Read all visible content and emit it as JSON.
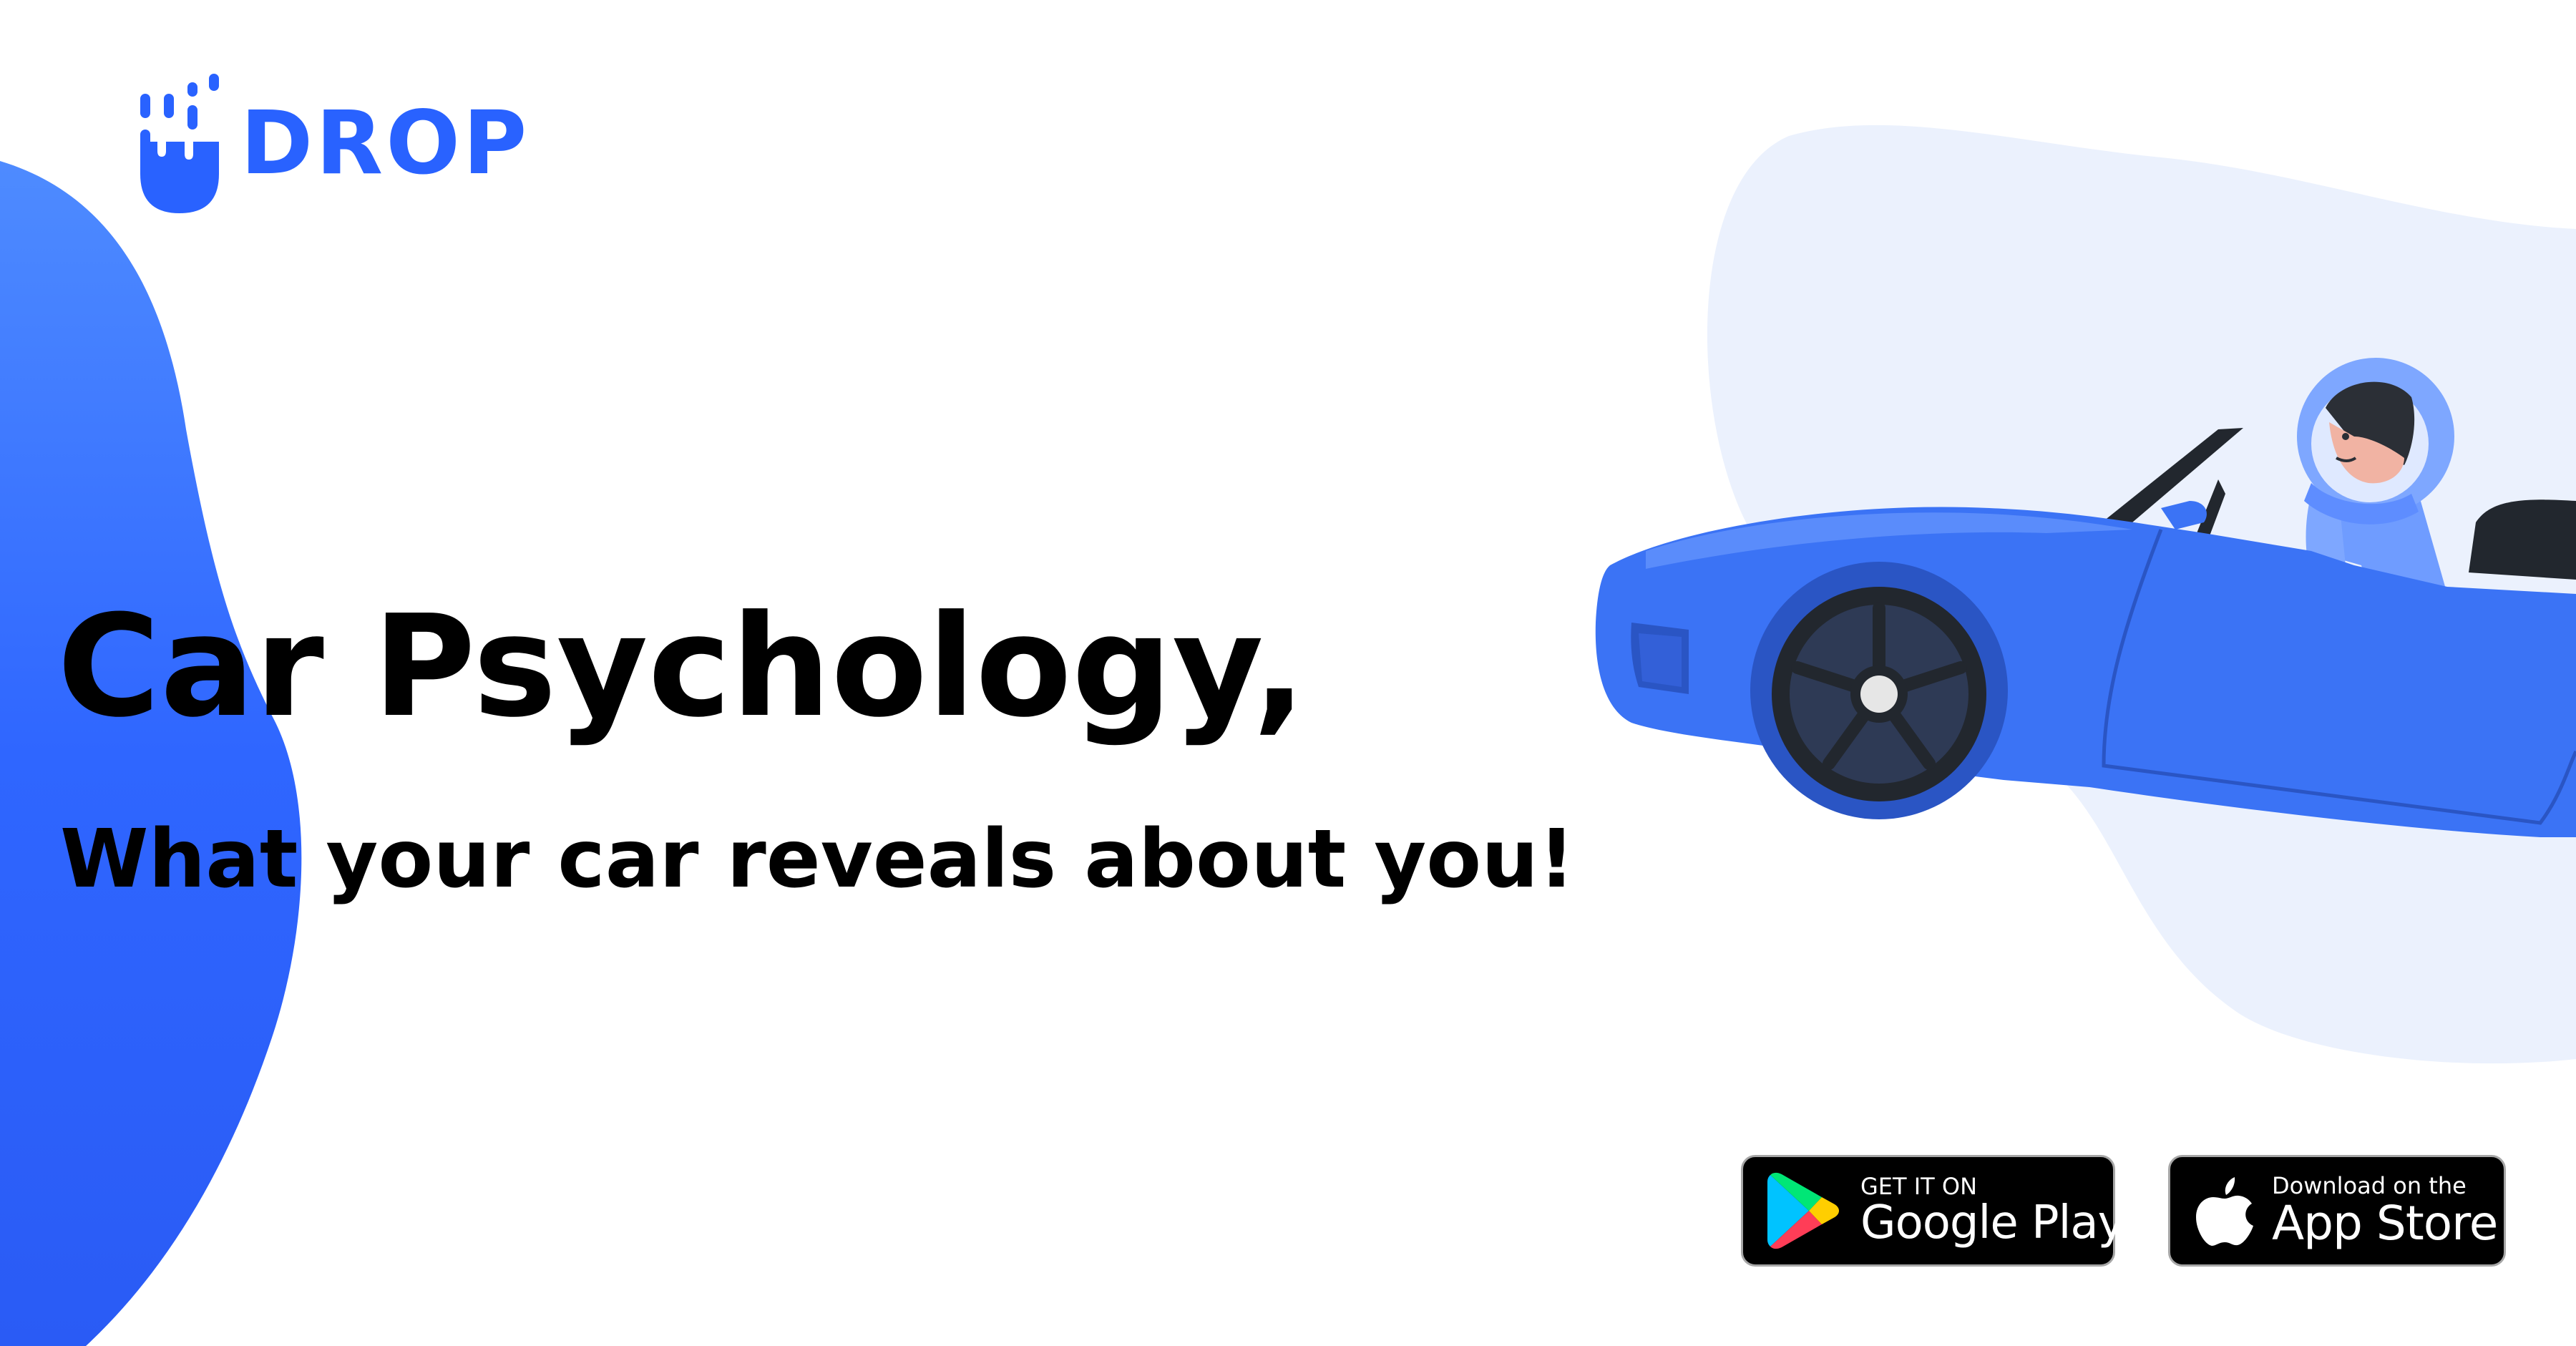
{
  "brand": {
    "name": "DROP",
    "primary_color": "#2962ff",
    "blob_color_light": "#4a86ff",
    "blob_color_dark": "#2a5bf5",
    "backdrop_color": "#ebf1fd"
  },
  "icons": {
    "logo": "drop-logo-icon",
    "google_play": "google-play-icon",
    "apple": "apple-icon"
  },
  "hero": {
    "title": "Car Psychology,",
    "subtitle": "What your car reveals about you!"
  },
  "store_badges": {
    "google_play": {
      "small_text": "GET IT ON",
      "large_text": "Google Play"
    },
    "app_store": {
      "small_text": "Download on the",
      "large_text": "App Store"
    }
  }
}
